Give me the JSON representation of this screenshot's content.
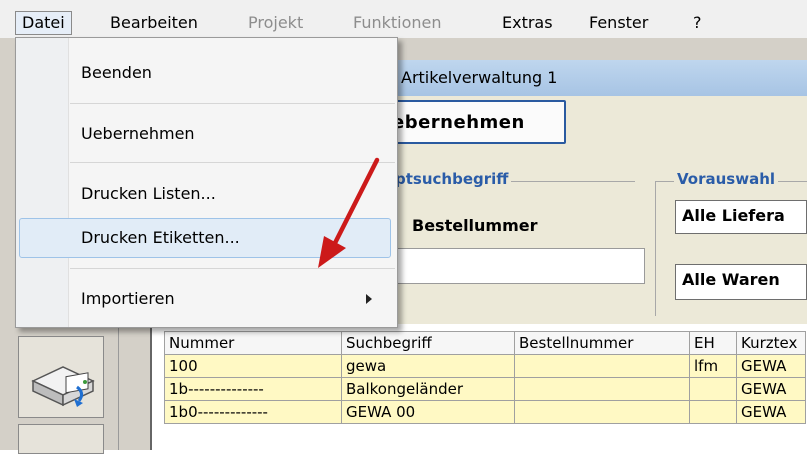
{
  "menubar": {
    "items": [
      {
        "label": "Datei",
        "enabled": true
      },
      {
        "label": "Bearbeiten",
        "enabled": true
      },
      {
        "label": "Projekt",
        "enabled": false
      },
      {
        "label": "Funktionen",
        "enabled": false
      },
      {
        "label": "Extras",
        "enabled": true
      },
      {
        "label": "Fenster",
        "enabled": true
      },
      {
        "label": "?",
        "enabled": true
      }
    ]
  },
  "dropdown": {
    "items": [
      {
        "label": "Beenden"
      },
      {
        "label": "Uebernehmen"
      },
      {
        "label": "Drucken Listen..."
      },
      {
        "label": "Drucken Etiketten...",
        "highlighted": true
      },
      {
        "label": "Importieren",
        "submenu": true
      }
    ]
  },
  "window": {
    "title": "Artikelverwaltung 1",
    "accept_button": "ebernehmen"
  },
  "search": {
    "group_main": "ptsuchbegriff",
    "field_label": "Bestellummer",
    "group_preselect": "Vorauswahl",
    "select_supplier": "Alle Liefera",
    "select_goods": "Alle Waren"
  },
  "table": {
    "columns": [
      "Nummer",
      "Suchbegriff",
      "Bestellnummer",
      "EH",
      "Kurztex"
    ],
    "rows": [
      [
        "100",
        "gewa",
        "",
        "lfm",
        "GEWA"
      ],
      [
        "1b--------------",
        "Balkongeländer",
        "",
        "",
        "GEWA"
      ],
      [
        "1b0-------------",
        "GEWA 00",
        "",
        "",
        "GEWA"
      ]
    ]
  },
  "colors": {
    "accent": "#2a5ca8",
    "row_highlight": "#fff9c4",
    "arrow": "#cc1a1a"
  },
  "icons": {
    "left_button": "printer-icon",
    "submenu": "chevron-right-icon"
  }
}
